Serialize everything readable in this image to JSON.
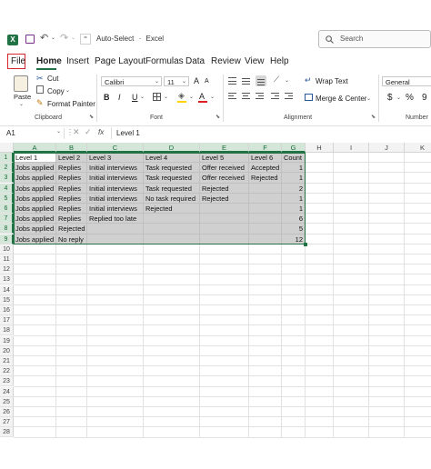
{
  "titlebar": {
    "autosave_label": "Auto-Select",
    "separator": "·",
    "app_name": "Excel",
    "search_placeholder": "Search"
  },
  "menu": [
    "File",
    "Home",
    "Insert",
    "Page Layout",
    "Formulas",
    "Data",
    "Review",
    "View",
    "Help"
  ],
  "ribbon": {
    "paste_label": "Paste",
    "cut_label": "Cut",
    "copy_label": "Copy",
    "format_painter_label": "Format Painter",
    "clipboard_group": "Clipboard",
    "font_name": "Calibri",
    "font_size": "11",
    "font_group": "Font",
    "wrap_text_label": "Wrap Text",
    "merge_center_label": "Merge & Center",
    "alignment_group": "Alignment",
    "number_format": "General",
    "number_group": "Number",
    "bold": "B",
    "italic": "I",
    "underline": "U",
    "grow_font": "A",
    "shrink_font": "A",
    "currency": "$",
    "percent": "%",
    "comma": "9"
  },
  "formula_bar": {
    "name_box": "A1",
    "fx": "fx",
    "value": "Level 1"
  },
  "columns": [
    "A",
    "B",
    "C",
    "D",
    "E",
    "F",
    "G",
    "H",
    "I",
    "J",
    "K"
  ],
  "rows": [
    "1",
    "2",
    "3",
    "4",
    "5",
    "6",
    "7",
    "8",
    "9",
    "10",
    "11",
    "12",
    "13",
    "14",
    "15",
    "16",
    "17",
    "18",
    "19",
    "20",
    "21",
    "22",
    "23",
    "24",
    "25",
    "26",
    "27",
    "28"
  ],
  "cells": [
    [
      "Level 1",
      "Level 2",
      "Level 3",
      "Level 4",
      "Level 5",
      "Level 6",
      "Count"
    ],
    [
      "Jobs applied",
      "Replies",
      "Initial interviews",
      "Task requested",
      "Offer received",
      "Accepted",
      "1"
    ],
    [
      "Jobs applied",
      "Replies",
      "Initial interviews",
      "Task requested",
      "Offer received",
      "Rejected",
      "1"
    ],
    [
      "Jobs applied",
      "Replies",
      "Initial interviews",
      "Task requested",
      "Rejected",
      "",
      "2"
    ],
    [
      "Jobs applied",
      "Replies",
      "Initial interviews",
      "No task required",
      "Rejected",
      "",
      "1"
    ],
    [
      "Jobs applied",
      "Replies",
      "Initial interviews",
      "Rejected",
      "",
      "",
      "1"
    ],
    [
      "Jobs applied",
      "Replies",
      "Replied too late",
      "",
      "",
      "",
      "6"
    ],
    [
      "Jobs applied",
      "Rejected",
      "",
      "",
      "",
      "",
      "5"
    ],
    [
      "Jobs applied",
      "No reply",
      "",
      "",
      "",
      "",
      "12"
    ]
  ],
  "colors": {
    "excel_green": "#217346",
    "selection_fill": "#d0d0d0",
    "file_highlight": "#d9262c"
  }
}
